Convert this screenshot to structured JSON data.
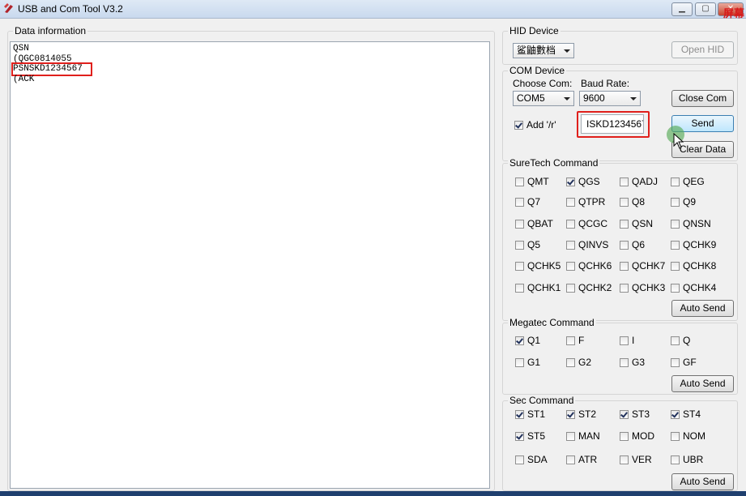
{
  "window": {
    "title": "USB and Com Tool V3.2",
    "overlay_text": "屏幕"
  },
  "data_info": {
    "legend": "Data information",
    "lines": [
      "QSN",
      "(QGC0814055",
      "PSNSKD1234567",
      "(ACK"
    ]
  },
  "hid": {
    "legend": "HID Device",
    "selected": "鲨鼬數档",
    "open_label": "Open HID"
  },
  "com": {
    "legend": "COM Device",
    "choose_label": "Choose Com:",
    "baud_label": "Baud Rate:",
    "com_value": "COM5",
    "baud_value": "9600",
    "close_label": "Close Com",
    "add_r_label": "Add '/r'",
    "add_r_checked": true,
    "send_input": "ISKD1234567",
    "send_label": "Send",
    "clear_label": "Clear Data"
  },
  "suretech": {
    "legend": "SureTech Command",
    "items": [
      {
        "label": "QMT",
        "checked": false
      },
      {
        "label": "QGS",
        "checked": true
      },
      {
        "label": "QADJ",
        "checked": false
      },
      {
        "label": "QEG",
        "checked": false
      },
      {
        "label": "Q7",
        "checked": false
      },
      {
        "label": "QTPR",
        "checked": false
      },
      {
        "label": "Q8",
        "checked": false
      },
      {
        "label": "Q9",
        "checked": false
      },
      {
        "label": "QBAT",
        "checked": false
      },
      {
        "label": "QCGC",
        "checked": false
      },
      {
        "label": "QSN",
        "checked": false
      },
      {
        "label": "QNSN",
        "checked": false
      },
      {
        "label": "Q5",
        "checked": false
      },
      {
        "label": "QINVS",
        "checked": false
      },
      {
        "label": "Q6",
        "checked": false
      },
      {
        "label": "QCHK9",
        "checked": false
      },
      {
        "label": "QCHK5",
        "checked": false
      },
      {
        "label": "QCHK6",
        "checked": false
      },
      {
        "label": "QCHK7",
        "checked": false
      },
      {
        "label": "QCHK8",
        "checked": false
      },
      {
        "label": "QCHK1",
        "checked": false
      },
      {
        "label": "QCHK2",
        "checked": false
      },
      {
        "label": "QCHK3",
        "checked": false
      },
      {
        "label": "QCHK4",
        "checked": false
      }
    ],
    "auto_send_label": "Auto Send"
  },
  "megatec": {
    "legend": "Megatec Command",
    "items": [
      {
        "label": "Q1",
        "checked": true
      },
      {
        "label": "F",
        "checked": false
      },
      {
        "label": "I",
        "checked": false
      },
      {
        "label": "Q",
        "checked": false
      },
      {
        "label": "G1",
        "checked": false
      },
      {
        "label": "G2",
        "checked": false
      },
      {
        "label": "G3",
        "checked": false
      },
      {
        "label": "GF",
        "checked": false
      }
    ],
    "auto_send_label": "Auto Send"
  },
  "sec": {
    "legend": "Sec Command",
    "items": [
      {
        "label": "ST1",
        "checked": true
      },
      {
        "label": "ST2",
        "checked": true
      },
      {
        "label": "ST3",
        "checked": true
      },
      {
        "label": "ST4",
        "checked": true
      },
      {
        "label": "ST5",
        "checked": true
      },
      {
        "label": "MAN",
        "checked": false
      },
      {
        "label": "MOD",
        "checked": false
      },
      {
        "label": "NOM",
        "checked": false
      },
      {
        "label": "SDA",
        "checked": false
      },
      {
        "label": "ATR",
        "checked": false
      },
      {
        "label": "VER",
        "checked": false
      },
      {
        "label": "UBR",
        "checked": false
      }
    ],
    "auto_send_label": "Auto Send"
  }
}
